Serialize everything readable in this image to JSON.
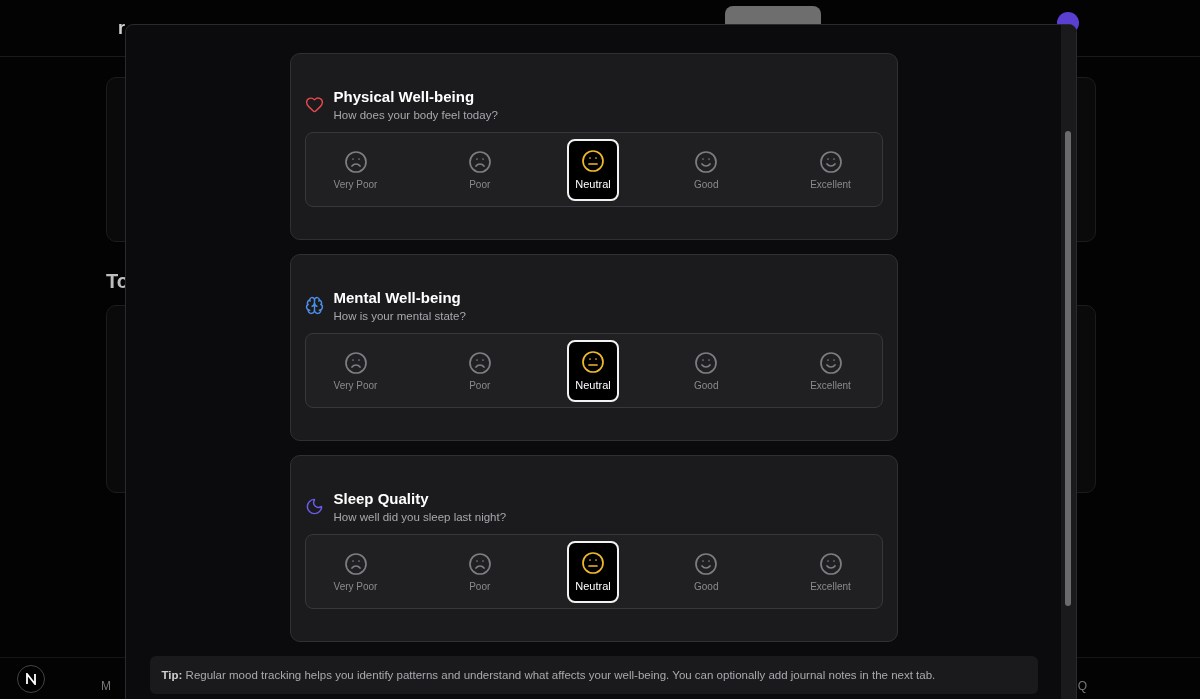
{
  "background_page": {
    "header_text": "r",
    "section_heading": "To",
    "footer_left": "M",
    "footer_right": "Q"
  },
  "sections": [
    {
      "kind": "heart",
      "title": "Physical Well-being",
      "subtitle": "How does your body feel today?",
      "options": [
        {
          "kind": "frown",
          "label": "Very Poor",
          "selected": false
        },
        {
          "kind": "frown",
          "label": "Poor",
          "selected": false
        },
        {
          "kind": "meh",
          "label": "Neutral",
          "selected": true
        },
        {
          "kind": "smile",
          "label": "Good",
          "selected": false
        },
        {
          "kind": "smile",
          "label": "Excellent",
          "selected": false
        }
      ]
    },
    {
      "kind": "brain",
      "title": "Mental Well-being",
      "subtitle": "How is your mental state?",
      "options": [
        {
          "kind": "frown",
          "label": "Very Poor",
          "selected": false
        },
        {
          "kind": "frown",
          "label": "Poor",
          "selected": false
        },
        {
          "kind": "meh",
          "label": "Neutral",
          "selected": true
        },
        {
          "kind": "smile",
          "label": "Good",
          "selected": false
        },
        {
          "kind": "smile",
          "label": "Excellent",
          "selected": false
        }
      ]
    },
    {
      "kind": "moon",
      "title": "Sleep Quality",
      "subtitle": "How well did you sleep last night?",
      "options": [
        {
          "kind": "frown",
          "label": "Very Poor",
          "selected": false
        },
        {
          "kind": "frown",
          "label": "Poor",
          "selected": false
        },
        {
          "kind": "meh",
          "label": "Neutral",
          "selected": true
        },
        {
          "kind": "smile",
          "label": "Good",
          "selected": false
        },
        {
          "kind": "smile",
          "label": "Excellent",
          "selected": false
        }
      ]
    }
  ],
  "tip": "**Tip:** Regular mood tracking helps you identify patterns and understand what affects your well-being. You can optionally add journal notes in the next tab."
}
